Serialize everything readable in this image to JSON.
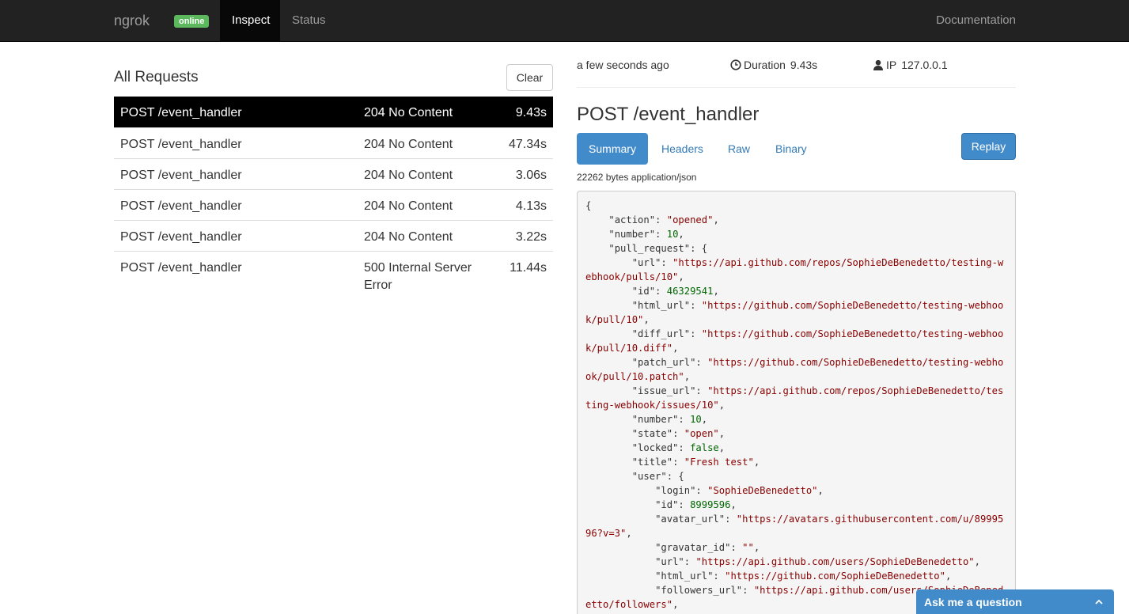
{
  "navbar": {
    "brand": "ngrok",
    "badge": "online",
    "tabs": [
      {
        "label": "Inspect"
      },
      {
        "label": "Status"
      }
    ],
    "docs": "Documentation"
  },
  "requests": {
    "title": "All Requests",
    "clear_label": "Clear",
    "rows": [
      {
        "path": "POST /event_handler",
        "status": "204 No Content",
        "duration": "9.43s"
      },
      {
        "path": "POST /event_handler",
        "status": "204 No Content",
        "duration": "47.34s"
      },
      {
        "path": "POST /event_handler",
        "status": "204 No Content",
        "duration": "3.06s"
      },
      {
        "path": "POST /event_handler",
        "status": "204 No Content",
        "duration": "4.13s"
      },
      {
        "path": "POST /event_handler",
        "status": "204 No Content",
        "duration": "3.22s"
      },
      {
        "path": "POST /event_handler",
        "status": "500 Internal Server Error",
        "duration": "11.44s"
      }
    ]
  },
  "detail": {
    "time_ago": "a few seconds ago",
    "duration_label": "Duration",
    "duration_value": "9.43s",
    "ip_label": "IP",
    "ip_value": "127.0.0.1",
    "title": "POST /event_handler",
    "tabs": {
      "summary": "Summary",
      "headers": "Headers",
      "raw": "Raw",
      "binary": "Binary"
    },
    "replay_label": "Replay",
    "size_info": "22262 bytes application/json",
    "body_lines": [
      [
        {
          "t": "p",
          "v": "{"
        }
      ],
      [
        {
          "t": "p",
          "v": "    \"action\": "
        },
        {
          "t": "s",
          "v": "\"opened\""
        },
        {
          "t": "p",
          "v": ","
        }
      ],
      [
        {
          "t": "p",
          "v": "    \"number\": "
        },
        {
          "t": "n",
          "v": "10"
        },
        {
          "t": "p",
          "v": ","
        }
      ],
      [
        {
          "t": "p",
          "v": "    \"pull_request\": {"
        }
      ],
      [
        {
          "t": "p",
          "v": "        \"url\": "
        },
        {
          "t": "s",
          "v": "\"https://api.github.com/repos/SophieDeBenedetto/testing-webhook/pulls/10\""
        },
        {
          "t": "p",
          "v": ","
        }
      ],
      [
        {
          "t": "p",
          "v": "        \"id\": "
        },
        {
          "t": "n",
          "v": "46329541"
        },
        {
          "t": "p",
          "v": ","
        }
      ],
      [
        {
          "t": "p",
          "v": "        \"html_url\": "
        },
        {
          "t": "s",
          "v": "\"https://github.com/SophieDeBenedetto/testing-webhook/pull/10\""
        },
        {
          "t": "p",
          "v": ","
        }
      ],
      [
        {
          "t": "p",
          "v": "        \"diff_url\": "
        },
        {
          "t": "s",
          "v": "\"https://github.com/SophieDeBenedetto/testing-webhook/pull/10.diff\""
        },
        {
          "t": "p",
          "v": ","
        }
      ],
      [
        {
          "t": "p",
          "v": "        \"patch_url\": "
        },
        {
          "t": "s",
          "v": "\"https://github.com/SophieDeBenedetto/testing-webhook/pull/10.patch\""
        },
        {
          "t": "p",
          "v": ","
        }
      ],
      [
        {
          "t": "p",
          "v": "        \"issue_url\": "
        },
        {
          "t": "s",
          "v": "\"https://api.github.com/repos/SophieDeBenedetto/testing-webhook/issues/10\""
        },
        {
          "t": "p",
          "v": ","
        }
      ],
      [
        {
          "t": "p",
          "v": "        \"number\": "
        },
        {
          "t": "n",
          "v": "10"
        },
        {
          "t": "p",
          "v": ","
        }
      ],
      [
        {
          "t": "p",
          "v": "        \"state\": "
        },
        {
          "t": "s",
          "v": "\"open\""
        },
        {
          "t": "p",
          "v": ","
        }
      ],
      [
        {
          "t": "p",
          "v": "        \"locked\": "
        },
        {
          "t": "n",
          "v": "false"
        },
        {
          "t": "p",
          "v": ","
        }
      ],
      [
        {
          "t": "p",
          "v": "        \"title\": "
        },
        {
          "t": "s",
          "v": "\"Fresh test\""
        },
        {
          "t": "p",
          "v": ","
        }
      ],
      [
        {
          "t": "p",
          "v": "        \"user\": {"
        }
      ],
      [
        {
          "t": "p",
          "v": "            \"login\": "
        },
        {
          "t": "s",
          "v": "\"SophieDeBenedetto\""
        },
        {
          "t": "p",
          "v": ","
        }
      ],
      [
        {
          "t": "p",
          "v": "            \"id\": "
        },
        {
          "t": "n",
          "v": "8999596"
        },
        {
          "t": "p",
          "v": ","
        }
      ],
      [
        {
          "t": "p",
          "v": "            \"avatar_url\": "
        },
        {
          "t": "s",
          "v": "\"https://avatars.githubusercontent.com/u/8999596?v=3\""
        },
        {
          "t": "p",
          "v": ","
        }
      ],
      [
        {
          "t": "p",
          "v": "            \"gravatar_id\": "
        },
        {
          "t": "s",
          "v": "\"\""
        },
        {
          "t": "p",
          "v": ","
        }
      ],
      [
        {
          "t": "p",
          "v": "            \"url\": "
        },
        {
          "t": "s",
          "v": "\"https://api.github.com/users/SophieDeBenedetto\""
        },
        {
          "t": "p",
          "v": ","
        }
      ],
      [
        {
          "t": "p",
          "v": "            \"html_url\": "
        },
        {
          "t": "s",
          "v": "\"https://github.com/SophieDeBenedetto\""
        },
        {
          "t": "p",
          "v": ","
        }
      ],
      [
        {
          "t": "p",
          "v": "            \"followers_url\": "
        },
        {
          "t": "s",
          "v": "\"https://api.github.com/users/SophieDeBenedetto/followers\""
        },
        {
          "t": "p",
          "v": ","
        }
      ]
    ]
  },
  "ask_widget": {
    "label": "Ask me a question"
  }
}
